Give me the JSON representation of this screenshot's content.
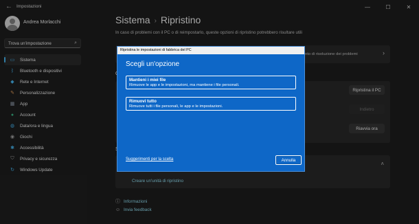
{
  "window": {
    "title": "Impostazioni",
    "back_icon": "back-arrow-icon",
    "controls": [
      "minimize-icon",
      "maximize-icon",
      "close-icon"
    ]
  },
  "sidebar": {
    "user_name": "Andrea Morlacchi",
    "search_placeholder": "Trova un'impostazione",
    "items": [
      {
        "label": "Sistema",
        "icon": "monitor-icon",
        "color": "#4cc2ff",
        "active": true
      },
      {
        "label": "Bluetooth e dispositivi",
        "icon": "bluetooth-icon",
        "color": "#4cc2ff"
      },
      {
        "label": "Rete e Internet",
        "icon": "wifi-icon",
        "color": "#4cc2ff"
      },
      {
        "label": "Personalizzazione",
        "icon": "brush-icon",
        "color": "#f0a860"
      },
      {
        "label": "App",
        "icon": "apps-icon",
        "color": "#9aa8b8"
      },
      {
        "label": "Account",
        "icon": "person-icon",
        "color": "#3ec28f"
      },
      {
        "label": "Data/ora e lingua",
        "icon": "globe-clock-icon",
        "color": "#4cc2ff"
      },
      {
        "label": "Giochi",
        "icon": "gamepad-icon",
        "color": "#b0b0b0"
      },
      {
        "label": "Accessibilità",
        "icon": "accessibility-icon",
        "color": "#4cc2ff"
      },
      {
        "label": "Privacy e sicurezza",
        "icon": "shield-icon",
        "color": "#b0b0b0"
      },
      {
        "label": "Windows Update",
        "icon": "update-icon",
        "color": "#4cc2ff"
      }
    ]
  },
  "main": {
    "breadcrumb_parent": "Sistema",
    "breadcrumb_current": "Ripristino",
    "description": "In caso di problemi con il PC o di reimpostarlo, queste opzioni di ripristino potrebbero risultare utili",
    "troubleshoot_text": "nto di risoluzione dei problemi",
    "section_stub_o": "O",
    "section_stub_s": "S",
    "reset_button": "Ripristina il PC",
    "back_button": "Indietro",
    "restart_button": "Riavvia ora",
    "create_drive_link": "Creare un'unità di ripristino",
    "info_link": "Informazioni",
    "feedback_link": "Invia feedback"
  },
  "dialog": {
    "title": "Ripristina le impostazioni di fabbrica del PC",
    "heading": "Scegli un'opzione",
    "options": [
      {
        "title": "Mantieni i miei file",
        "description": "Rimuove le app e le impostazioni, ma mantiene i file personali."
      },
      {
        "title": "Rimuovi tutto",
        "description": "Rimuove tutti i file personali, le app e le impostazioni."
      }
    ],
    "help_link": "Suggerimenti per la scelta",
    "cancel_button": "Annulla",
    "background_color": "#0e67c7"
  }
}
